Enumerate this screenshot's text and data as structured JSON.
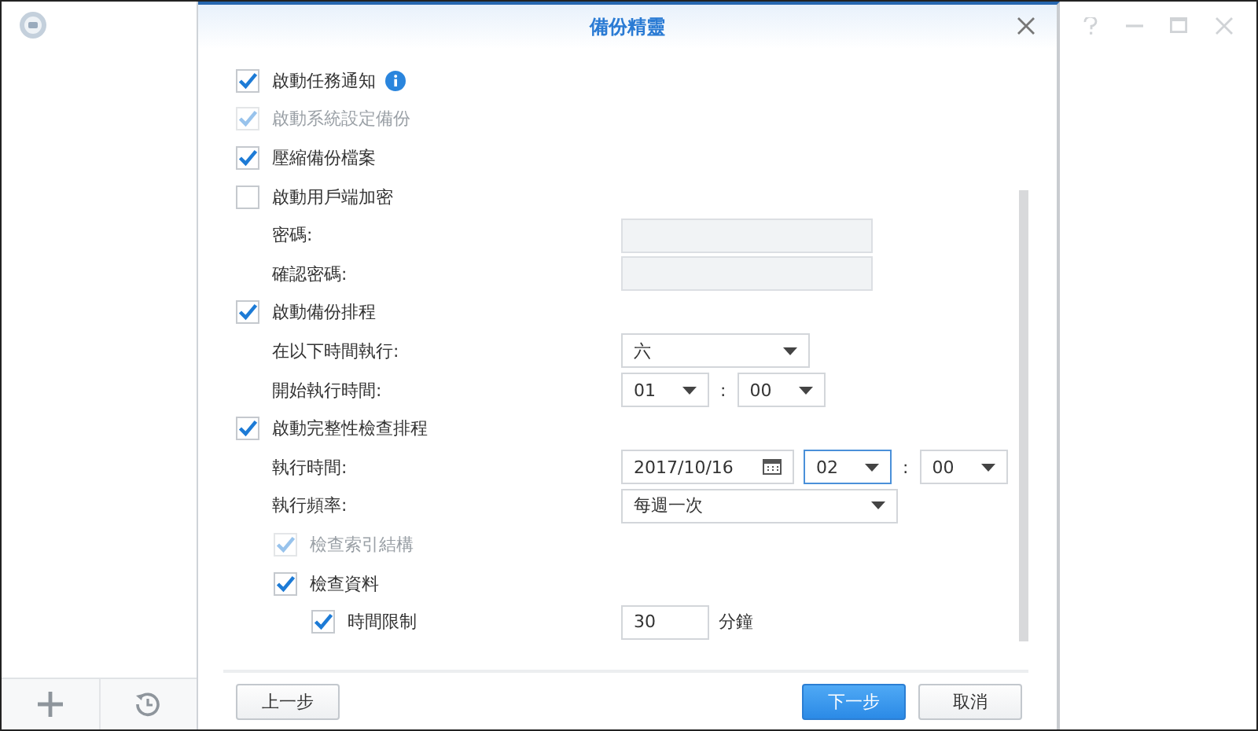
{
  "dialog": {
    "title": "備份精靈",
    "items": [
      {
        "kind": "checkbox",
        "label": "啟動任務通知",
        "checked": true,
        "disabled": false,
        "has_info": true
      },
      {
        "kind": "checkbox",
        "label": "啟動系統設定備份",
        "checked": true,
        "disabled": true,
        "has_info": false
      },
      {
        "kind": "checkbox",
        "label": "壓縮備份檔案",
        "checked": true,
        "disabled": false,
        "has_info": false
      },
      {
        "kind": "checkbox",
        "label": "啟動用戶端加密",
        "checked": false,
        "disabled": false,
        "has_info": false,
        "children": [
          {
            "kind": "field",
            "label": "密碼:",
            "controls": [
              {
                "kind": "text",
                "disabled": true,
                "focused": false
              }
            ]
          },
          {
            "kind": "field",
            "label": "確認密碼:",
            "controls": [
              {
                "kind": "text",
                "disabled": true,
                "focused": false
              }
            ]
          }
        ]
      },
      {
        "kind": "checkbox",
        "label": "啟動備份排程",
        "checked": true,
        "disabled": false,
        "has_info": false,
        "children": [
          {
            "kind": "field",
            "label": "在以下時間執行:",
            "controls": [
              {
                "kind": "select",
                "value": "六",
                "wide": false,
                "focused": false
              }
            ]
          },
          {
            "kind": "field",
            "label": "開始執行時間:",
            "controls": [
              {
                "kind": "time",
                "value": "01",
                "focused": false
              },
              {
                "kind": "colon",
                "value": ":"
              },
              {
                "kind": "time",
                "value": "00",
                "focused": false
              }
            ]
          }
        ]
      },
      {
        "kind": "checkbox",
        "label": "啟動完整性檢查排程",
        "checked": true,
        "disabled": false,
        "has_info": false,
        "children": [
          {
            "kind": "field",
            "label": "執行時間:",
            "controls": [
              {
                "kind": "date",
                "value": "2017/10/16",
                "focused": false
              },
              {
                "kind": "time",
                "value": "02",
                "focused": true
              },
              {
                "kind": "colon",
                "value": ":"
              },
              {
                "kind": "time",
                "value": "00",
                "focused": false
              }
            ]
          },
          {
            "kind": "field",
            "label": "執行頻率:",
            "controls": [
              {
                "kind": "select",
                "value": "每週一次",
                "wide": true,
                "focused": false
              }
            ]
          },
          {
            "kind": "checkbox",
            "label": "檢查索引結構",
            "checked": true,
            "disabled": true,
            "has_info": false
          },
          {
            "kind": "checkbox",
            "label": "檢查資料",
            "checked": true,
            "disabled": false,
            "has_info": false,
            "children": [
              {
                "kind": "checkbox",
                "label": "時間限制",
                "checked": true,
                "disabled": false,
                "has_info": false,
                "controls": [
                  {
                    "kind": "number",
                    "value": "30",
                    "focused": false
                  },
                  {
                    "kind": "unit",
                    "value": "分鐘"
                  }
                ]
              }
            ]
          }
        ]
      }
    ],
    "buttons": [
      {
        "label": "上一步",
        "kind": "default"
      },
      {
        "label": "下一步",
        "kind": "primary"
      },
      {
        "label": "取消",
        "kind": "default"
      }
    ]
  }
}
